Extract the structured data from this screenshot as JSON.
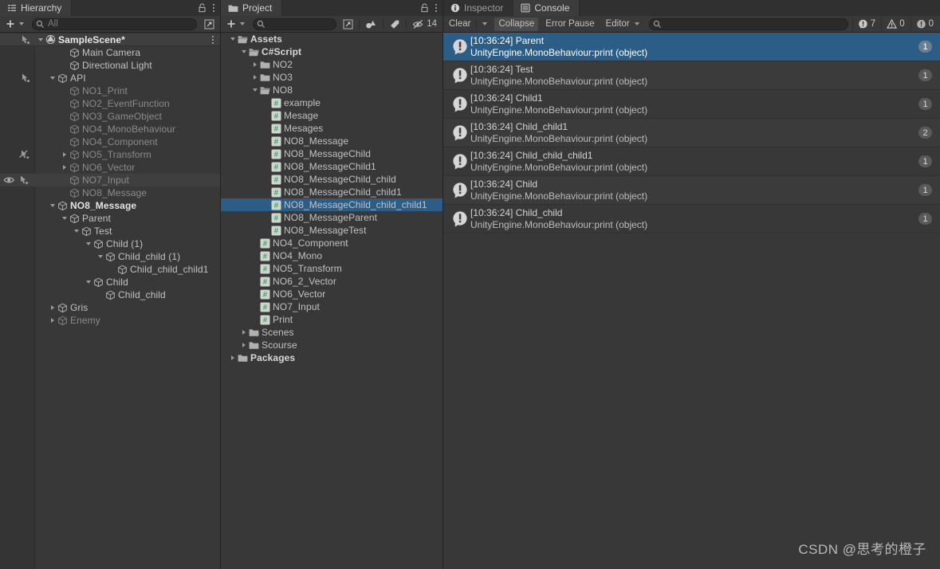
{
  "hierarchy": {
    "tab": {
      "label": "Hierarchy",
      "icon": "hierarchy-icon"
    },
    "toolbar": {
      "add_label": "+",
      "search_placeholder": "All"
    },
    "scene": {
      "name": "SampleScene*"
    },
    "items": [
      {
        "label": "Main Camera",
        "depth": 2,
        "twisty": "none",
        "state": "normal",
        "gutter": "none"
      },
      {
        "label": "Directional Light",
        "depth": 2,
        "twisty": "none",
        "state": "normal",
        "gutter": "none"
      },
      {
        "label": "API",
        "depth": 1,
        "twisty": "down",
        "state": "normal",
        "gutter": "pick"
      },
      {
        "label": "NO1_Print",
        "depth": 2,
        "twisty": "none",
        "state": "dim",
        "gutter": "none"
      },
      {
        "label": "NO2_EventFunction",
        "depth": 2,
        "twisty": "none",
        "state": "dim",
        "gutter": "none"
      },
      {
        "label": "NO3_GameObject",
        "depth": 2,
        "twisty": "none",
        "state": "dim",
        "gutter": "none"
      },
      {
        "label": "NO4_MonoBehaviour",
        "depth": 2,
        "twisty": "none",
        "state": "dim",
        "gutter": "none"
      },
      {
        "label": "NO4_Component",
        "depth": 2,
        "twisty": "none",
        "state": "dim",
        "gutter": "none"
      },
      {
        "label": "NO5_Transform",
        "depth": 2,
        "twisty": "right",
        "state": "dim",
        "gutter": "nopick"
      },
      {
        "label": "NO6_Vector",
        "depth": 2,
        "twisty": "right",
        "state": "dim",
        "gutter": "none"
      },
      {
        "label": "NO7_Input",
        "depth": 2,
        "twisty": "none",
        "state": "dim",
        "gutter": "eyepick",
        "hovered": true
      },
      {
        "label": "NO8_Message",
        "depth": 2,
        "twisty": "none",
        "state": "dim",
        "gutter": "none"
      },
      {
        "label": "NO8_Message",
        "depth": 1,
        "twisty": "down",
        "state": "bold",
        "gutter": "none"
      },
      {
        "label": "Parent",
        "depth": 2,
        "twisty": "down",
        "state": "normal",
        "gutter": "none"
      },
      {
        "label": "Test",
        "depth": 3,
        "twisty": "down",
        "state": "normal",
        "gutter": "none"
      },
      {
        "label": "Child (1)",
        "depth": 4,
        "twisty": "down",
        "state": "normal",
        "gutter": "none"
      },
      {
        "label": "Child_child (1)",
        "depth": 5,
        "twisty": "down",
        "state": "normal",
        "gutter": "none"
      },
      {
        "label": "Child_child_child1",
        "depth": 6,
        "twisty": "none",
        "state": "normal",
        "gutter": "none"
      },
      {
        "label": "Child",
        "depth": 4,
        "twisty": "down",
        "state": "normal",
        "gutter": "none"
      },
      {
        "label": "Child_child",
        "depth": 5,
        "twisty": "none",
        "state": "normal",
        "gutter": "none"
      },
      {
        "label": "Gris",
        "depth": 1,
        "twisty": "right",
        "state": "normal",
        "gutter": "none"
      },
      {
        "label": "Enemy",
        "depth": 1,
        "twisty": "right",
        "state": "dim",
        "gutter": "none"
      }
    ]
  },
  "project": {
    "tab": {
      "label": "Project",
      "icon": "folder-icon"
    },
    "toolbar": {
      "add_label": "+",
      "search_placeholder": "",
      "hidden_count": "14",
      "icons": [
        "search-expand-icon",
        "filter-type-icon",
        "label-tag-icon",
        "hidden-eye-icon"
      ]
    },
    "items": [
      {
        "label": "Assets",
        "depth": 0,
        "twisty": "down",
        "kind": "folder",
        "bold": true
      },
      {
        "label": "C#Script",
        "depth": 1,
        "twisty": "down",
        "kind": "folder",
        "bold": true
      },
      {
        "label": "NO2",
        "depth": 2,
        "twisty": "right",
        "kind": "folder"
      },
      {
        "label": "NO3",
        "depth": 2,
        "twisty": "right",
        "kind": "folder"
      },
      {
        "label": "NO8",
        "depth": 2,
        "twisty": "down",
        "kind": "folder"
      },
      {
        "label": "example",
        "depth": 3,
        "twisty": "none",
        "kind": "script"
      },
      {
        "label": "Mesage",
        "depth": 3,
        "twisty": "none",
        "kind": "script"
      },
      {
        "label": "Mesages",
        "depth": 3,
        "twisty": "none",
        "kind": "script"
      },
      {
        "label": "NO8_Message",
        "depth": 3,
        "twisty": "none",
        "kind": "script"
      },
      {
        "label": "NO8_MessageChild",
        "depth": 3,
        "twisty": "none",
        "kind": "script"
      },
      {
        "label": "NO8_MessageChild1",
        "depth": 3,
        "twisty": "none",
        "kind": "script"
      },
      {
        "label": "NO8_MessageChild_child",
        "depth": 3,
        "twisty": "none",
        "kind": "script"
      },
      {
        "label": "NO8_MessageChild_child1",
        "depth": 3,
        "twisty": "none",
        "kind": "script"
      },
      {
        "label": "NO8_MessageChild_child_child1",
        "depth": 3,
        "twisty": "none",
        "kind": "script",
        "selected": true
      },
      {
        "label": "NO8_MessageParent",
        "depth": 3,
        "twisty": "none",
        "kind": "script"
      },
      {
        "label": "NO8_MessageTest",
        "depth": 3,
        "twisty": "none",
        "kind": "script"
      },
      {
        "label": "NO4_Component",
        "depth": 2,
        "twisty": "none",
        "kind": "script"
      },
      {
        "label": "NO4_Mono",
        "depth": 2,
        "twisty": "none",
        "kind": "script"
      },
      {
        "label": "NO5_Transform",
        "depth": 2,
        "twisty": "none",
        "kind": "script"
      },
      {
        "label": "NO6_2_Vector",
        "depth": 2,
        "twisty": "none",
        "kind": "script"
      },
      {
        "label": "NO6_Vector",
        "depth": 2,
        "twisty": "none",
        "kind": "script"
      },
      {
        "label": "NO7_Input",
        "depth": 2,
        "twisty": "none",
        "kind": "script"
      },
      {
        "label": "Print",
        "depth": 2,
        "twisty": "none",
        "kind": "script"
      },
      {
        "label": "Scenes",
        "depth": 1,
        "twisty": "right",
        "kind": "folder"
      },
      {
        "label": "Scourse",
        "depth": 1,
        "twisty": "right",
        "kind": "folder"
      },
      {
        "label": "Packages",
        "depth": 0,
        "twisty": "right",
        "kind": "folder",
        "bold": true
      }
    ]
  },
  "console": {
    "tabs": [
      {
        "label": "Inspector",
        "icon": "info-icon",
        "active": false
      },
      {
        "label": "Console",
        "icon": "console-icon",
        "active": true
      }
    ],
    "toolbar": {
      "clear_label": "Clear",
      "collapse_label": "Collapse",
      "error_pause_label": "Error Pause",
      "editor_label": "Editor",
      "search_placeholder": ""
    },
    "counters": {
      "error_icon": "error-count-icon",
      "error_count": "7",
      "warning_icon": "warning-count-icon",
      "warning_count": "0",
      "info_icon": "info-count-icon",
      "info_count": "0"
    },
    "logs": [
      {
        "message": "[10:36:24] Parent",
        "stack": "UnityEngine.MonoBehaviour:print (object)",
        "count": "1",
        "selected": true
      },
      {
        "message": "[10:36:24] Test",
        "stack": "UnityEngine.MonoBehaviour:print (object)",
        "count": "1"
      },
      {
        "message": "[10:36:24] Child1",
        "stack": "UnityEngine.MonoBehaviour:print (object)",
        "count": "1"
      },
      {
        "message": "[10:36:24] Child_child1",
        "stack": "UnityEngine.MonoBehaviour:print (object)",
        "count": "2"
      },
      {
        "message": "[10:36:24] Child_child_child1",
        "stack": "UnityEngine.MonoBehaviour:print (object)",
        "count": "1"
      },
      {
        "message": "[10:36:24] Child",
        "stack": "UnityEngine.MonoBehaviour:print (object)",
        "count": "1"
      },
      {
        "message": "[10:36:24] Child_child",
        "stack": "UnityEngine.MonoBehaviour:print (object)",
        "count": "1"
      }
    ]
  },
  "watermark": {
    "text": "CSDN @思考的橙子"
  },
  "colors": {
    "selection_blue": "#2c5d87",
    "panel_bg": "#383838",
    "toolbar_bg": "#393939",
    "script_icon_green": "#4caf7d"
  }
}
